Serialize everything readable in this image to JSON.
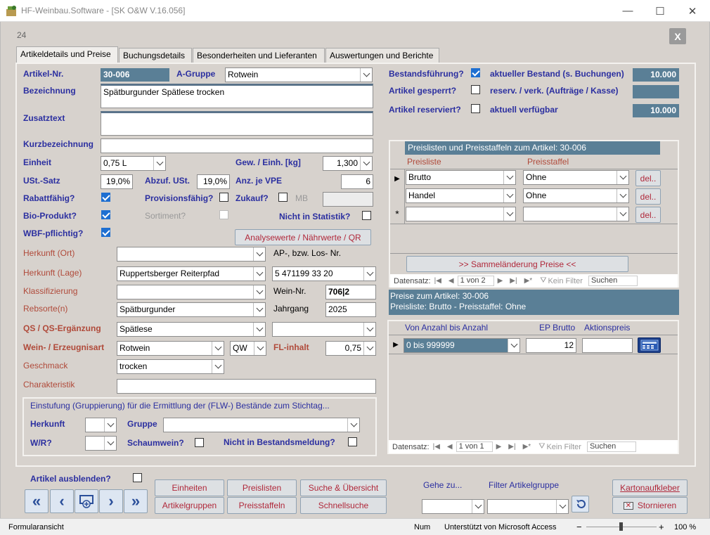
{
  "window": {
    "title": "HF-Weinbau.Software - [SK O&W V.16.056]",
    "minimize": "—",
    "maximize": "☐",
    "close": "✕"
  },
  "form": {
    "record_hint": "24",
    "close_x": "X"
  },
  "tabs": [
    "Artikeldetails und Preise",
    "Buchungsdetails",
    "Besonderheiten und Lieferanten",
    "Auswertungen und Berichte"
  ],
  "fields": {
    "artikel_nr_label": "Artikel-Nr.",
    "artikel_nr": "30-006",
    "agruppe_label": "A-Gruppe",
    "agruppe": "Rotwein",
    "bezeichnung_label": "Bezeichnung",
    "bezeichnung": "Spätburgunder Spätlese trocken",
    "zusatztext_label": "Zusatztext",
    "zusatztext": "",
    "kurz_label": "Kurzbezeichnung",
    "kurz": "",
    "einheit_label": "Einheit",
    "einheit": "0,75 L",
    "gew_label": "Gew. / Einh. [kg]",
    "gew": "1,300",
    "ust_label": "USt.-Satz",
    "ust": "19,0%",
    "abzuf_label": "Abzuf. USt.",
    "abzuf": "19,0%",
    "vpe_label": "Anz. je VPE",
    "vpe": "6",
    "rabatt_label": "Rabattfähig?",
    "prov_label": "Provisionsfähig?",
    "zukauf_label": "Zukauf?",
    "mb_label": "MB",
    "bio_label": "Bio-Produkt?",
    "sortiment_label": "Sortiment?",
    "statistik_label": "Nicht in Statistik?",
    "wbf_label": "WBF-pflichtig?",
    "analyse_btn": "Analysewerte / Nährwerte / QR",
    "herkunft_ort_label": "Herkunft (Ort)",
    "ap_label": "AP-, bzw. Los- Nr.",
    "herkunft_lage_label": "Herkunft (Lage)",
    "herkunft_lage": "Ruppertsberger Reiterpfad",
    "ap_nr": "5 471199 33 20",
    "klass_label": "Klassifizierung",
    "weinnr_label": "Wein-Nr.",
    "weinnr": "706|2",
    "rebsorte_label": "Rebsorte(n)",
    "rebsorte": "Spätburgunder",
    "jahrgang_label": "Jahrgang",
    "jahrgang": "2025",
    "qs_label": "QS / QS-Ergänzung",
    "qs": "Spätlese",
    "weinart_label": "Wein- / Erzeugnisart",
    "weinart": "Rotwein",
    "weinart2": "QW",
    "fl_label": "FL-inhalt",
    "fl": "0,75",
    "geschmack_label": "Geschmack",
    "geschmack": "trocken",
    "charakt_label": "Charakteristik"
  },
  "einstufung": {
    "title": "Einstufung (Gruppierung) für die Ermittlung der (FLW-) Bestände zum Stichtag...",
    "herkunft_label": "Herkunft",
    "gruppe_label": "Gruppe",
    "wr_label": "W/R?",
    "schaum_label": "Schaumwein?",
    "bestand_label": "Nicht in Bestandsmeldung?"
  },
  "bestand": {
    "fuehrung_label": "Bestandsführung?",
    "aktuell_label": "aktueller Bestand (s. Buchungen)",
    "aktuell": "10.000",
    "gesperrt_label": "Artikel gesperrt?",
    "reserv_label": "reserv. / verk. (Aufträge / Kasse)",
    "reserviert_label": "Artikel reserviert?",
    "verfuegbar_label": "aktuell verfügbar",
    "verfuegbar": "10.000"
  },
  "preislisten": {
    "title": "Preislisten und Preisstaffeln zum Artikel: 30-006",
    "col1": "Preisliste",
    "col2": "Preisstaffel",
    "rows": [
      {
        "liste": "Brutto",
        "staffel": "Ohne",
        "del": "del.."
      },
      {
        "liste": "Handel",
        "staffel": "Ohne",
        "del": "del.."
      },
      {
        "liste": "",
        "staffel": "",
        "del": "del.."
      }
    ],
    "sammel_btn": ">> Sammeländerung Preise <<",
    "nav_label": "Datensatz:",
    "nav_pos": "1 von 2",
    "filter": "Kein Filter",
    "search": "Suchen"
  },
  "preise": {
    "info1": "Preise zum Artikel: 30-006",
    "info2": "Preisliste: Brutto - Preisstaffel: Ohne",
    "col1": "Von Anzahl bis Anzahl",
    "col2": "EP Brutto",
    "col3": "Aktionspreis",
    "row": {
      "range": "0 bis 999999",
      "ep": "12",
      "aktion": ""
    },
    "nav_label": "Datensatz:",
    "nav_pos": "1 von 1",
    "filter": "Kein Filter",
    "search": "Suchen"
  },
  "bottom": {
    "ausblenden_label": "Artikel ausblenden?",
    "einheiten": "Einheiten",
    "preislisten": "Preislisten",
    "suche": "Suche & Übersicht",
    "artikelgruppen": "Artikelgruppen",
    "preisstaffeln": "Preisstaffeln",
    "schnellsuche": "Schnellsuche",
    "gehe_label": "Gehe zu...",
    "filter_label": "Filter Artikelgruppe",
    "karton": "Kartonaufkleber",
    "stornieren": "Stornieren"
  },
  "statusbar": {
    "left": "Formularansicht",
    "num": "Num",
    "powered": "Unterstützt von Microsoft Access",
    "zoom": "100 %"
  },
  "colors": {
    "accent": "#2b2fa0",
    "label_red": "#b04a3a",
    "dark_field": "#5a7f96"
  }
}
